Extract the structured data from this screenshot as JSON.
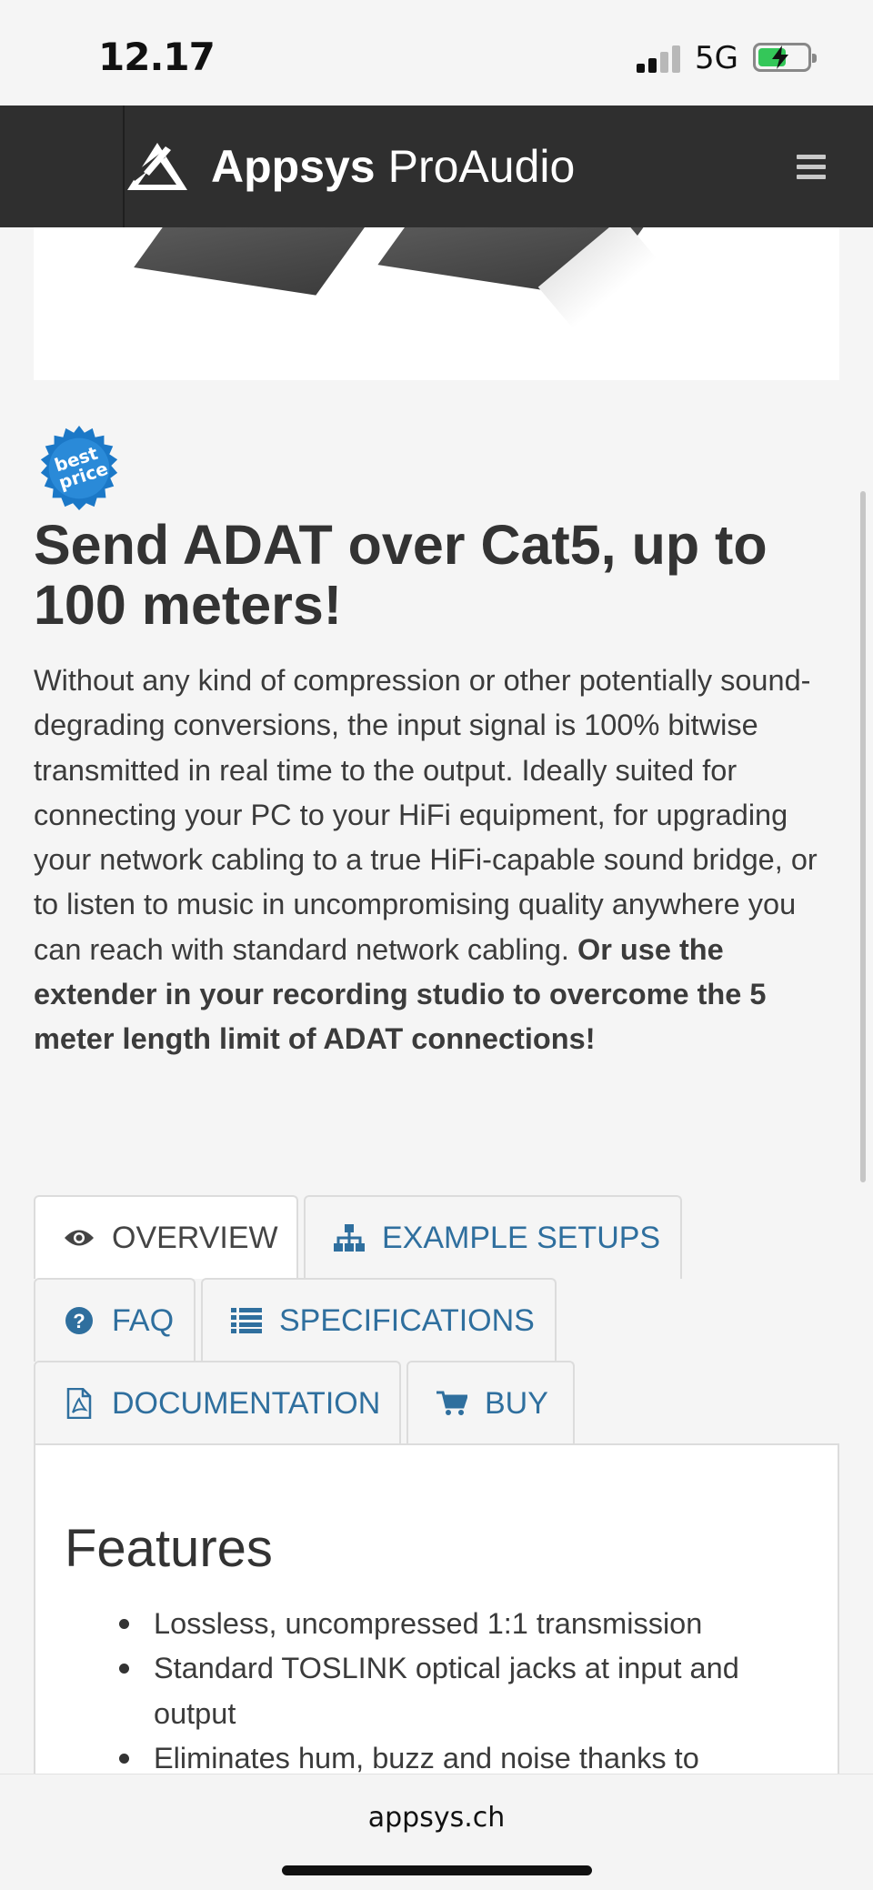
{
  "status": {
    "time": "12.17",
    "network": "5G"
  },
  "header": {
    "brand_bold": "Appsys",
    "brand_light": "ProAudio"
  },
  "badge": {
    "line1": "best",
    "line2": "price"
  },
  "article": {
    "headline": "Send ADAT over Cat5, up to 100 meters!",
    "intro_text": "Without any kind of compression or other potentially sound-degrading conversions, the input signal is 100% bitwise transmitted in real time to the output. Ideally suited for connecting your PC to your HiFi equipment, for upgrading your network cabling to a true HiFi-capable sound bridge, or to listen to music in uncompromising quality anywhere you can reach with standard network cabling. ",
    "intro_bold": "Or use the extender in your recording studio to overcome the 5 meter length limit of ADAT connections!"
  },
  "tabs": [
    {
      "label": "OVERVIEW",
      "icon": "eye-icon",
      "active": true
    },
    {
      "label": "EXAMPLE SETUPS",
      "icon": "sitemap-icon",
      "active": false
    },
    {
      "label": "FAQ",
      "icon": "question-circle-icon",
      "active": false
    },
    {
      "label": "SPECIFICATIONS",
      "icon": "list-icon",
      "active": false
    },
    {
      "label": "DOCUMENTATION",
      "icon": "pdf-file-icon",
      "active": false
    },
    {
      "label": "BUY",
      "icon": "cart-icon",
      "active": false
    }
  ],
  "panel": {
    "title": "Features",
    "features": [
      "Lossless, uncompressed 1:1 transmission",
      "Standard TOSLINK optical jacks at input and output",
      "Eliminates hum, buzz and noise thanks to"
    ]
  },
  "browser": {
    "url": "appsys.ch"
  },
  "colors": {
    "navbar": "#2f2f2f",
    "link": "#2f6f9e",
    "badge": "#1b78c7",
    "battery": "#34c759"
  }
}
